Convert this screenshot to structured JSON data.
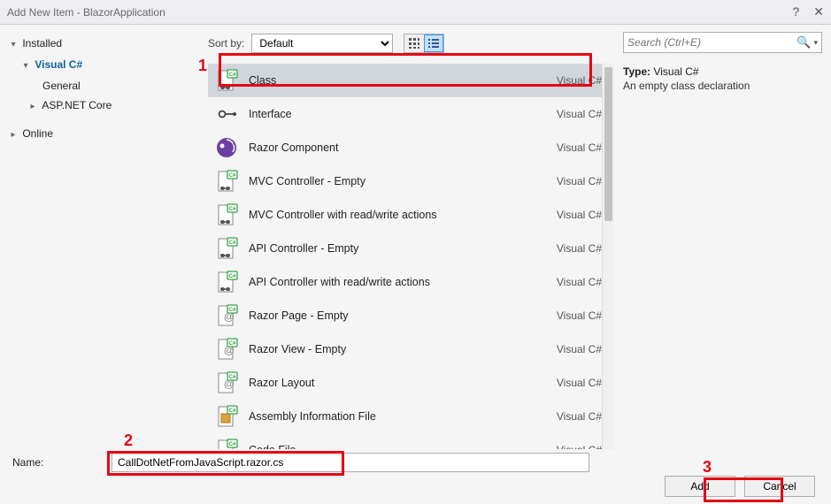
{
  "window": {
    "title": "Add New Item - BlazorApplication",
    "help_icon": "?",
    "close_icon": "✕"
  },
  "tree": {
    "installed": "Installed",
    "visual_csharp": "Visual C#",
    "general": "General",
    "aspnet_core": "ASP.NET Core",
    "online": "Online"
  },
  "toolbar": {
    "sort_by_label": "Sort by:",
    "sort_value": "Default"
  },
  "search": {
    "placeholder": "Search (Ctrl+E)"
  },
  "templates": [
    {
      "name": "Class",
      "lang": "Visual C#",
      "icon": "cs-file",
      "selected": true
    },
    {
      "name": "Interface",
      "lang": "Visual C#",
      "icon": "interface"
    },
    {
      "name": "Razor Component",
      "lang": "Visual C#",
      "icon": "razor-comp"
    },
    {
      "name": "MVC Controller - Empty",
      "lang": "Visual C#",
      "icon": "cs-file"
    },
    {
      "name": "MVC Controller with read/write actions",
      "lang": "Visual C#",
      "icon": "cs-file"
    },
    {
      "name": "API Controller - Empty",
      "lang": "Visual C#",
      "icon": "cs-file"
    },
    {
      "name": "API Controller with read/write actions",
      "lang": "Visual C#",
      "icon": "cs-file"
    },
    {
      "name": "Razor Page - Empty",
      "lang": "Visual C#",
      "icon": "razor-page"
    },
    {
      "name": "Razor View - Empty",
      "lang": "Visual C#",
      "icon": "razor-page"
    },
    {
      "name": "Razor Layout",
      "lang": "Visual C#",
      "icon": "razor-page"
    },
    {
      "name": "Assembly Information File",
      "lang": "Visual C#",
      "icon": "asm-file"
    },
    {
      "name": "Code File",
      "lang": "Visual C#",
      "icon": "cs-file"
    }
  ],
  "details": {
    "type_label": "Type:",
    "type_value": "Visual C#",
    "description": "An empty class declaration"
  },
  "name_field": {
    "label": "Name:",
    "value": "CallDotNetFromJavaScript.razor.cs"
  },
  "buttons": {
    "add": "Add",
    "cancel": "Cancel"
  },
  "callouts": {
    "n1": "1",
    "n2": "2",
    "n3": "3"
  }
}
